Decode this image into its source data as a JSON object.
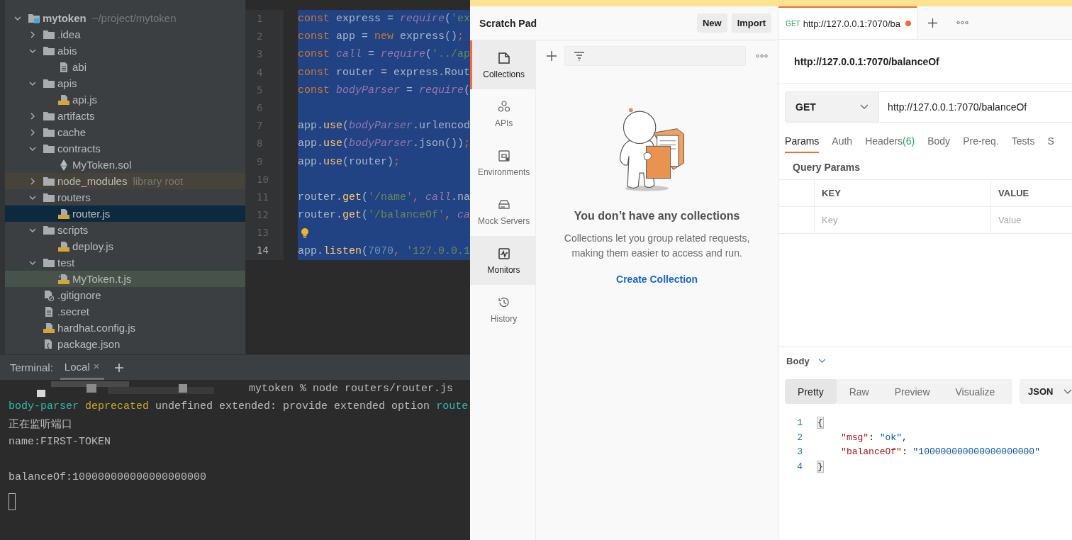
{
  "project_tree": [
    {
      "name": "mytoken",
      "hint": "~/project/mytoken",
      "kind": "root",
      "expanded": true,
      "selected": false,
      "children": [
        {
          "name": ".idea",
          "kind": "folder",
          "expanded": false,
          "selected": false
        },
        {
          "name": "abis",
          "kind": "folder",
          "expanded": true,
          "selected": false,
          "children": [
            {
              "name": "abi",
              "kind": "text",
              "selected": false
            }
          ]
        },
        {
          "name": "apis",
          "kind": "folder",
          "expanded": true,
          "selected": false,
          "children": [
            {
              "name": "api.js",
              "kind": "js",
              "selected": false
            }
          ]
        },
        {
          "name": "artifacts",
          "kind": "folder",
          "expanded": false,
          "selected": false
        },
        {
          "name": "cache",
          "kind": "folder",
          "expanded": false,
          "selected": false
        },
        {
          "name": "contracts",
          "kind": "folder",
          "expanded": true,
          "selected": false,
          "children": [
            {
              "name": "MyToken.sol",
              "kind": "sol",
              "selected": false
            }
          ]
        },
        {
          "name": "node_modules",
          "hint": "library root",
          "kind": "library",
          "expanded": false,
          "selected": false
        },
        {
          "name": "routers",
          "kind": "folder",
          "expanded": true,
          "selected": false,
          "children": [
            {
              "name": "router.js",
              "kind": "js",
              "selected": true
            }
          ]
        },
        {
          "name": "scripts",
          "kind": "folder",
          "expanded": true,
          "selected": false,
          "children": [
            {
              "name": "deploy.js",
              "kind": "js",
              "selected": false
            }
          ]
        },
        {
          "name": "test",
          "kind": "folder",
          "expanded": true,
          "selected": false,
          "children": [
            {
              "name": "MyToken.t.js",
              "kind": "test-js",
              "selected": false
            }
          ]
        },
        {
          "name": ".gitignore",
          "kind": "ignore",
          "selected": false
        },
        {
          "name": ".secret",
          "kind": "text",
          "selected": false
        },
        {
          "name": "hardhat.config.js",
          "kind": "js",
          "selected": false
        },
        {
          "name": "package.json",
          "kind": "json",
          "selected": false
        }
      ]
    }
  ],
  "editor": {
    "lines": [
      {
        "number": "1",
        "current": false,
        "selected": true,
        "bulb": false,
        "tokens": [
          {
            "t": "const ",
            "kind": "kw"
          },
          {
            "t": "express = ",
            "kind": "plain"
          },
          {
            "t": "require",
            "kind": "global"
          },
          {
            "t": "(",
            "kind": "plain"
          },
          {
            "t": "'ex",
            "kind": "str"
          }
        ]
      },
      {
        "number": "2",
        "current": false,
        "selected": true,
        "bulb": false,
        "tokens": [
          {
            "t": "const ",
            "kind": "kw"
          },
          {
            "t": "app = ",
            "kind": "plain"
          },
          {
            "t": "new ",
            "kind": "kw"
          },
          {
            "t": "express()",
            "kind": "plain"
          },
          {
            "t": ";",
            "kind": "punct"
          }
        ]
      },
      {
        "number": "3",
        "current": false,
        "selected": true,
        "bulb": false,
        "tokens": [
          {
            "t": "const ",
            "kind": "kw"
          },
          {
            "t": "call",
            "kind": "global"
          },
          {
            "t": " = ",
            "kind": "plain"
          },
          {
            "t": "require",
            "kind": "global"
          },
          {
            "t": "(",
            "kind": "plain"
          },
          {
            "t": "'../ap",
            "kind": "str"
          }
        ]
      },
      {
        "number": "4",
        "current": false,
        "selected": true,
        "bulb": false,
        "tokens": [
          {
            "t": "const ",
            "kind": "kw"
          },
          {
            "t": "router = express.Rout",
            "kind": "plain"
          }
        ]
      },
      {
        "number": "5",
        "current": false,
        "selected": true,
        "bulb": false,
        "tokens": [
          {
            "t": "const ",
            "kind": "kw"
          },
          {
            "t": "bodyParser",
            "kind": "global"
          },
          {
            "t": " = ",
            "kind": "plain"
          },
          {
            "t": "require",
            "kind": "global"
          },
          {
            "t": "(",
            "kind": "plain"
          }
        ]
      },
      {
        "number": "6",
        "current": false,
        "selected": true,
        "bulb": false
      },
      {
        "number": "7",
        "current": false,
        "selected": true,
        "bulb": false,
        "tokens": [
          {
            "t": "app.",
            "kind": "plain"
          },
          {
            "t": "use",
            "kind": "method"
          },
          {
            "t": "(",
            "kind": "plain"
          },
          {
            "t": "bodyParser",
            "kind": "global"
          },
          {
            "t": ".urlencod",
            "kind": "plain"
          }
        ]
      },
      {
        "number": "8",
        "current": false,
        "selected": true,
        "bulb": false,
        "tokens": [
          {
            "t": "app.",
            "kind": "plain"
          },
          {
            "t": "use",
            "kind": "method"
          },
          {
            "t": "(",
            "kind": "plain"
          },
          {
            "t": "bodyParser",
            "kind": "global"
          },
          {
            "t": ".json())",
            "kind": "plain"
          },
          {
            "t": ";",
            "kind": "punct"
          }
        ]
      },
      {
        "number": "9",
        "current": false,
        "selected": true,
        "bulb": false,
        "tokens": [
          {
            "t": "app.",
            "kind": "plain"
          },
          {
            "t": "use",
            "kind": "method"
          },
          {
            "t": "(router)",
            "kind": "plain"
          },
          {
            "t": ";",
            "kind": "punct"
          }
        ]
      },
      {
        "number": "10",
        "current": false,
        "selected": true,
        "bulb": false
      },
      {
        "number": "11",
        "current": false,
        "selected": true,
        "bulb": false,
        "tokens": [
          {
            "t": "router.",
            "kind": "plain"
          },
          {
            "t": "get",
            "kind": "method"
          },
          {
            "t": "(",
            "kind": "plain"
          },
          {
            "t": "'/name'",
            "kind": "str"
          },
          {
            "t": ", ",
            "kind": "punct"
          },
          {
            "t": "call",
            "kind": "global"
          },
          {
            "t": ".na",
            "kind": "plain"
          }
        ]
      },
      {
        "number": "12",
        "current": false,
        "selected": true,
        "bulb": false,
        "tokens": [
          {
            "t": "router.",
            "kind": "plain"
          },
          {
            "t": "get",
            "kind": "method"
          },
          {
            "t": "(",
            "kind": "plain"
          },
          {
            "t": "'/balanceOf'",
            "kind": "str"
          },
          {
            "t": ", ",
            "kind": "punct"
          },
          {
            "t": "ca",
            "kind": "global"
          }
        ]
      },
      {
        "number": "13",
        "current": false,
        "selected": true,
        "bulb": true
      },
      {
        "number": "14",
        "current": true,
        "selected": true,
        "bulb": false,
        "tokens": [
          {
            "t": "app.",
            "kind": "plain"
          },
          {
            "t": "listen",
            "kind": "method"
          },
          {
            "t": "(",
            "kind": "plain"
          },
          {
            "t": "7070",
            "kind": "num"
          },
          {
            "t": ", ",
            "kind": "punct"
          },
          {
            "t": "'127.0.0.1",
            "kind": "str"
          }
        ]
      }
    ]
  },
  "terminal": {
    "title": "Terminal:",
    "tabs": [
      {
        "label": "Local",
        "selected": true
      }
    ],
    "cursor": true,
    "lines": [
      {
        "kind": "command",
        "segments": [
          {
            "t": "mytoken % node routers/router.js",
            "kind": "plain"
          }
        ]
      },
      {
        "kind": "output",
        "segments": [
          {
            "t": "body-parser ",
            "kind": "cyan"
          },
          {
            "t": "deprecated",
            "kind": "yellow"
          },
          {
            "t": " undefined extended: provide extended option ",
            "kind": "plain"
          },
          {
            "t": "route",
            "kind": "cyan"
          }
        ]
      },
      {
        "kind": "output",
        "segments": [
          {
            "t": "正在监听端口",
            "kind": "plain"
          }
        ]
      },
      {
        "kind": "output",
        "segments": [
          {
            "t": "name:FIRST-TOKEN",
            "kind": "plain"
          }
        ]
      },
      {
        "kind": "blank"
      },
      {
        "kind": "output",
        "segments": [
          {
            "t": "balanceOf:100000000000000000000",
            "kind": "plain"
          }
        ]
      }
    ]
  },
  "postman": {
    "workspace": {
      "title": "Scratch Pad",
      "buttons": [
        "New",
        "Import"
      ]
    },
    "nav": [
      {
        "label": "Collections",
        "selected": true,
        "hovered": false
      },
      {
        "label": "APIs",
        "selected": false,
        "hovered": false
      },
      {
        "label": "Environments",
        "selected": false,
        "hovered": false
      },
      {
        "label": "Mock Servers",
        "selected": false,
        "hovered": false
      },
      {
        "label": "Monitors",
        "selected": false,
        "hovered": true
      },
      {
        "label": "History",
        "selected": false,
        "hovered": false
      }
    ],
    "empty_state": {
      "title": "You don’t have any collections",
      "description": "Collections let you group related requests, making them easier to access and run.",
      "link": "Create Collection"
    },
    "request_tabs": [
      {
        "method": "GET",
        "title": "http://127.0.0.1:7070/ba",
        "unsaved": true,
        "selected": true
      }
    ],
    "request_title": "http://127.0.0.1:7070/balanceOf",
    "method": "GET",
    "url": "http://127.0.0.1:7070/balanceOf",
    "tabs": [
      {
        "label": "Params",
        "selected": true
      },
      {
        "label": "Auth",
        "selected": false
      },
      {
        "label": "Headers",
        "count": "(6)",
        "selected": false
      },
      {
        "label": "Body",
        "selected": false
      },
      {
        "label": "Pre-req.",
        "selected": false
      },
      {
        "label": "Tests",
        "selected": false
      },
      {
        "label": "S",
        "selected": false
      }
    ],
    "query_params": {
      "title": "Query Params",
      "columns": [
        "KEY",
        "VALUE"
      ],
      "placeholders": [
        "Key",
        "Value"
      ]
    },
    "response": {
      "title": "Body",
      "views": [
        {
          "label": "Pretty",
          "selected": true
        },
        {
          "label": "Raw",
          "selected": false
        },
        {
          "label": "Preview",
          "selected": false
        },
        {
          "label": "Visualize",
          "selected": false
        }
      ],
      "format": "JSON",
      "lines": [
        {
          "number": "1",
          "kind": "brace",
          "text": "{"
        },
        {
          "number": "2",
          "kind": "field",
          "key": "\"msg\"",
          "sep": ": ",
          "value": "\"ok\"",
          "comma": ","
        },
        {
          "number": "3",
          "kind": "field",
          "key": "\"balanceOf\"",
          "sep": ": ",
          "value": "\"100000000000000000000\""
        },
        {
          "number": "4",
          "kind": "brace",
          "text": "}"
        }
      ]
    }
  }
}
